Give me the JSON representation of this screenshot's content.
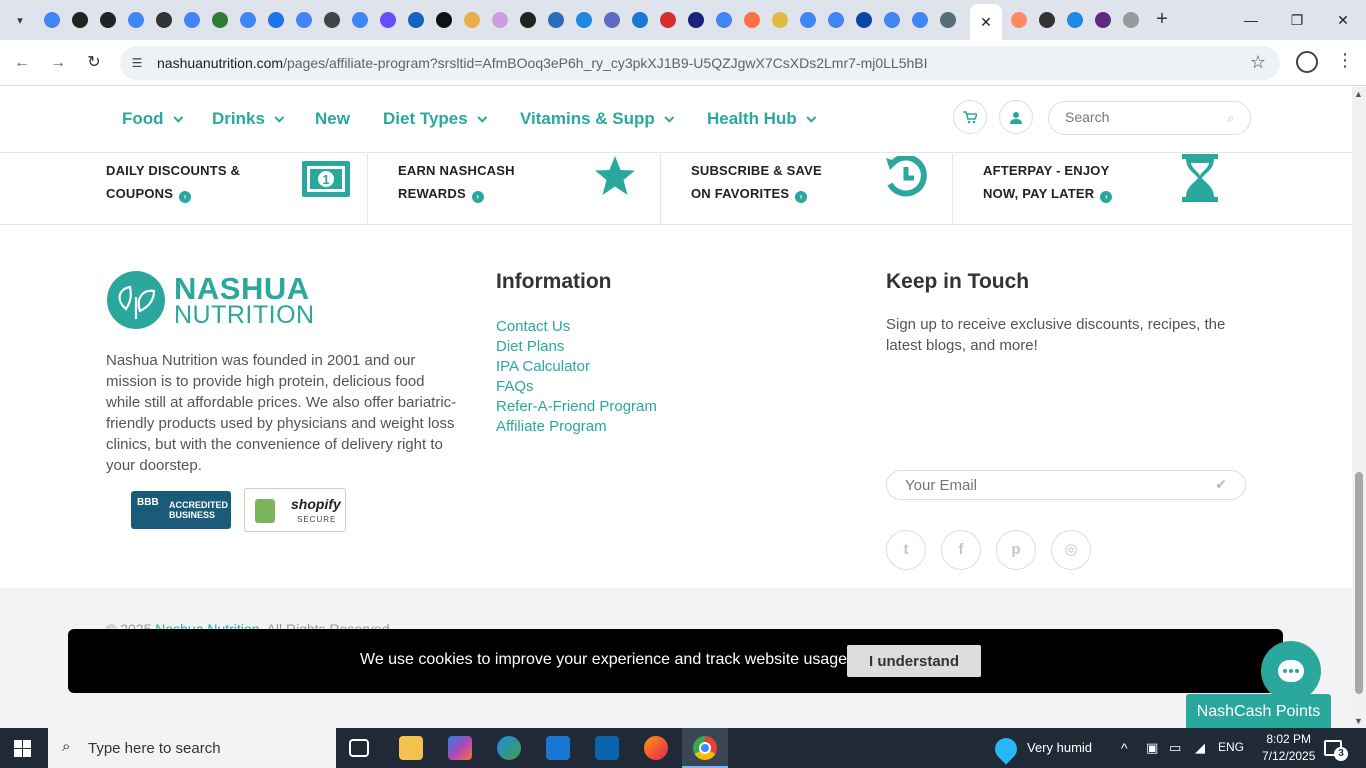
{
  "browser": {
    "url_host": "nashuanutrition.com",
    "url_path": "/pages/affiliate-program?srsltid=AfmBOoq3eP6h_ry_cy3pkXJ1B9-U5QZJgwX7CsXDs2Lmr7-mj0LL5hBI",
    "active_tab_close": "✕",
    "new_tab": "+",
    "tab_icon_colors": [
      "#4285f4",
      "#222222",
      "#222222",
      "#4285f4",
      "#333333",
      "#4285f4",
      "#2e7d32",
      "#4285f4",
      "#1a73e8",
      "#4285f4",
      "#444444",
      "#4285f4",
      "#6a4cff",
      "#1565c0",
      "#111111",
      "#e8b04c",
      "#c9a0dc",
      "#222222",
      "#2a6ebb",
      "#1e88e5",
      "#5c6bc0",
      "#1976d2",
      "#d32f2f",
      "#1a237e",
      "#4285f4",
      "#ff7043",
      "#e5b843",
      "#4285f4",
      "#4285f4",
      "#0d47a1",
      "#4285f4",
      "#4285f4",
      "#546e7a"
    ],
    "tab_icon_colors_right": [
      "#ff8a65",
      "#333333",
      "#1e88e5",
      "#5e2b7e",
      "#999999"
    ]
  },
  "site": {
    "nav": [
      {
        "label": "Food",
        "dropdown": true
      },
      {
        "label": "Drinks",
        "dropdown": true
      },
      {
        "label": "New",
        "dropdown": false
      },
      {
        "label": "Diet Types",
        "dropdown": true
      },
      {
        "label": "Vitamins & Supp",
        "dropdown": true
      },
      {
        "label": "Health Hub",
        "dropdown": true
      }
    ],
    "search_placeholder": "Search",
    "perks": [
      {
        "line1": "DAILY DISCOUNTS &",
        "line2": "COUPONS",
        "icon": "money-bill-icon"
      },
      {
        "line1": "EARN NASHCASH",
        "line2": "REWARDS",
        "icon": "star-icon"
      },
      {
        "line1": "SUBSCRIBE & SAVE",
        "line2": "ON FAVORITES",
        "icon": "history-icon"
      },
      {
        "line1": "AFTERPAY - ENJOY",
        "line2": "NOW, PAY LATER",
        "icon": "hourglass-icon"
      }
    ],
    "logo": {
      "name": "NASHUA",
      "sub": "NUTRITION"
    },
    "about": "Nashua Nutrition was founded in 2001 and our mission is to provide high protein, delicious food while still at affordable prices. We also offer bariatric-friendly products used by physicians and weight loss clinics, but with the convenience of delivery right to your doorstep.",
    "badges": {
      "bbb_mark": "BBB",
      "bbb_text": "ACCREDITED BUSINESS",
      "shopify_text": "shopify",
      "shopify_sub": "SECURE"
    },
    "information": {
      "title": "Information",
      "links": [
        "Contact Us",
        "Diet Plans",
        "IPA Calculator",
        "FAQs",
        "Refer-A-Friend Program",
        "Affiliate Program"
      ]
    },
    "keep_in_touch": {
      "title": "Keep in Touch",
      "text": "Sign up to receive exclusive discounts, recipes, the latest blogs, and more!",
      "email_placeholder": "Your Email"
    },
    "social": [
      {
        "icon": "twitter-icon",
        "glyph": "t"
      },
      {
        "icon": "facebook-icon",
        "glyph": "f"
      },
      {
        "icon": "pinterest-icon",
        "glyph": "p"
      },
      {
        "icon": "instagram-icon",
        "glyph": "◎"
      }
    ],
    "copyright_prefix": "© 2025",
    "copyright_brand": "Nashua Nutrition",
    "copyright_suffix": ". All Rights Reserved.",
    "cookie_message": "We use cookies to improve your experience and track website usage.",
    "cookie_button": "I understand",
    "nashcash_button": "NashCash Points",
    "accent_color": "#2ba89e"
  },
  "taskbar": {
    "search_text": "Type here to search",
    "weather": "Very humid",
    "language": "ENG",
    "time": "8:02 PM",
    "date": "7/12/2025",
    "notification_count": "3"
  }
}
